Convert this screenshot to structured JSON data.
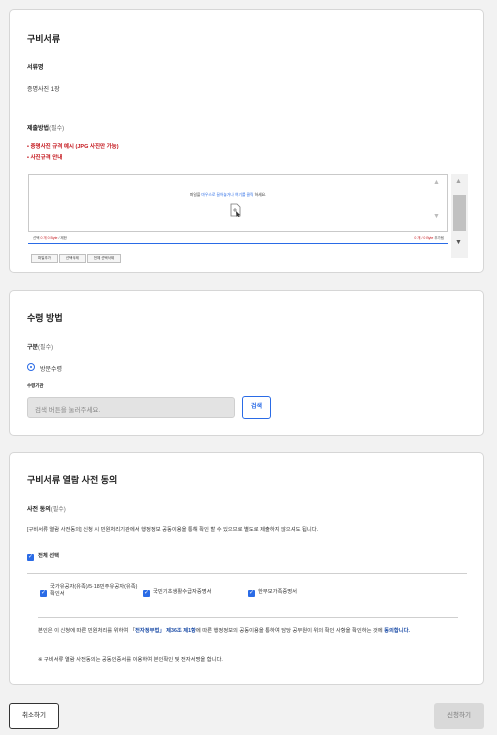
{
  "documents_section": {
    "title": "구비서류",
    "doc_name_label": "서류명",
    "doc_name_value": "증명사진 1장",
    "submit_method_label": "제출방법",
    "submit_method_required": "(필수)",
    "link_photo_example": "• 증명사진 규격 예시 (JPG 사진만 가능)",
    "link_photo_guide": "• 사진규격 안내",
    "upload": {
      "drop_message_prefix": "파일을",
      "drop_message_drag": "마우스로 끌어놓거나",
      "drop_message_click": "여기를 클릭",
      "drop_message_suffix": "하세요.",
      "info_left_prefix": "선택",
      "info_left_count": "0 개",
      "info_left_size": "0 Byte",
      "info_left_suffix": "/ 제한",
      "info_right_count": "0 개 /",
      "info_right_size": "0 Byte",
      "info_right_suffix": "추가됨",
      "btn_add": "파일추가",
      "btn_delete": "선택삭제",
      "btn_delete_all": "전체 선택삭제"
    }
  },
  "receive_section": {
    "title": "수령 방법",
    "type_label": "구분",
    "type_required": "(필수)",
    "radio_option": "방문수령",
    "place_label": "수령기관",
    "search_placeholder": "검색 버튼을 눌러주세요.",
    "search_button": "검색"
  },
  "consent_section": {
    "title": "구비서류 열람 사전 동의",
    "consent_label": "사전 동의",
    "consent_required": "(필수)",
    "consent_text": "[구비서류 열람 사전동의] 신청 시 민원처리기관에서 행정정보 공동이용을 통해 확인 할 수 있으므로 별도로 제출하지 않으셔도 됩니다.",
    "select_all": "전체 선택",
    "items": [
      "국가유공자(유족)/5·18민주유공자(유족)확인서",
      "국민기초생활수급자증명서",
      "한부모가족증명서"
    ],
    "notice_pre": "본인은 이 신청에 따른 민원처리를 위하여 「",
    "notice_law": "전자정부법」 제36조 제1항",
    "notice_mid": "에 따른 행정정보의 공동이용을 통하여 담당 공무원이 위의 확인 사항을 확인하는 것에",
    "notice_agree": "동의합니다.",
    "notice_2": "※ 구비서류 열람 사전동의는 공동인증서를 이용하여 본인확인 및 전자서명을 합니다."
  },
  "footer": {
    "cancel_button": "취소하기",
    "apply_button": "신청하기"
  },
  "colors": {
    "accent": "#2a6be6",
    "required_red": "#c4161c",
    "disabled": "#d9d9d9"
  }
}
